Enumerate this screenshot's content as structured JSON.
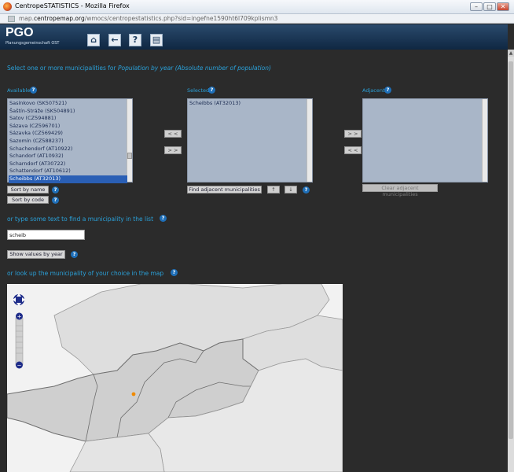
{
  "window": {
    "title": "CentropeSTATISTICS - Mozilla Firefox",
    "url_prefix": "map.",
    "url_domain": "centropemap.org",
    "url_rest": "/wmocs/centropestatistics.php?sid=ingefne1590ht6l709kplismn3",
    "minimize": "–",
    "maximize": "□",
    "close": "✕"
  },
  "header": {
    "logo": "PGO",
    "logo_sub": "Planungsgemeinschaft OST",
    "buttons": [
      "home-icon",
      "back-icon",
      "help-icon",
      "print-icon"
    ]
  },
  "page": {
    "heading_prefix": "Select one or more municipalities for ",
    "heading_topic": "Population by year (Absolute number of population)",
    "available_label": "Available",
    "selected_label": "Selected",
    "adjacent_label": "Adjacent",
    "help": "?",
    "available_items": [
      "Sasínkovo (SK507521)",
      "Šaštín-Stráže (SK504891)",
      "Satov (CZ594881)",
      "Sázava (CZ596701)",
      "Sázavka (CZ569429)",
      "Sazomín (CZ588237)",
      "Schachendorf (AT10922)",
      "Schandorf (AT10932)",
      "Scharndorf (AT30722)",
      "Schattendorf (AT10612)",
      "Scheibbs (AT32013)"
    ],
    "available_selected_index": 10,
    "selected_items": [
      "Scheibbs (AT32013)"
    ],
    "btn_remove": "< <",
    "btn_add": "> >",
    "btn_add_adjacent": "> >",
    "btn_remove_adjacent": "< <",
    "sort_by_name": "Sort by name",
    "sort_by_code": "Sort by code",
    "find_adjacent": "Find adjacent municipalities",
    "move_up": "↑",
    "move_down": "↓",
    "clear_adjacent": "Clear adjacent municipalities",
    "type_heading": "or type some text to find a municipality in the list",
    "search_value": "scheib",
    "show_values": "Show values by year",
    "map_heading": "or look up the municipality of your choice in the map"
  },
  "map": {
    "zoom_in": "+",
    "zoom_out": "−",
    "marker_color": "#f08a00"
  }
}
